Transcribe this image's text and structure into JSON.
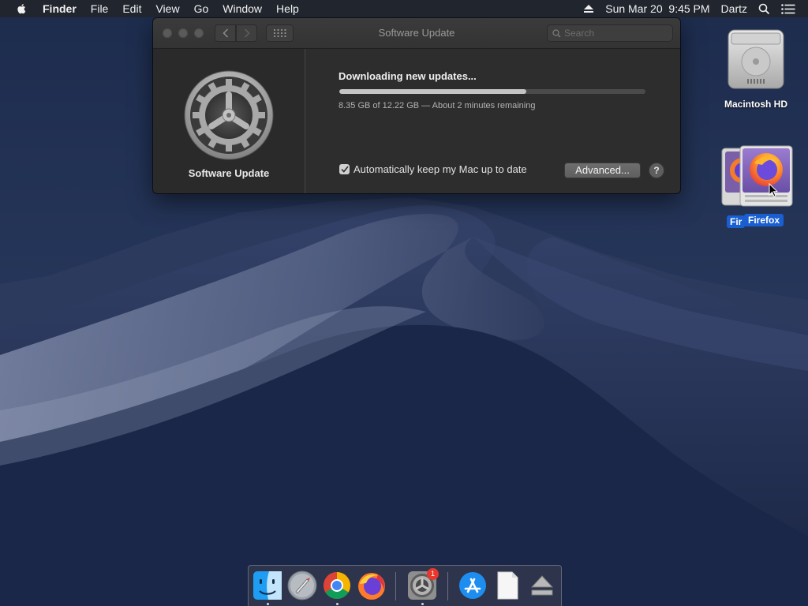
{
  "menubar": {
    "app_name": "Finder",
    "menus": [
      "File",
      "Edit",
      "View",
      "Go",
      "Window",
      "Help"
    ],
    "datetime": "Sun Mar 20  9:45 PM",
    "user": "Dartz"
  },
  "window": {
    "title": "Software Update",
    "search_placeholder": "Search",
    "pane_label": "Software Update",
    "status": "Downloading new updates...",
    "progress_fraction": 0.61,
    "progress_detail": "8.35 GB of 12.22 GB — About 2 minutes remaining",
    "auto_update_label": "Automatically keep my Mac up to date",
    "auto_update_checked": true,
    "advanced_label": "Advanced...",
    "help_label": "?"
  },
  "desktop": {
    "icons": [
      {
        "label": "Macintosh HD",
        "icon": "hard-drive-icon"
      },
      {
        "label": "Firefox",
        "icon": "firefox-disk-image-icon"
      }
    ],
    "firefox_back_label": "Fir"
  },
  "dock": {
    "items": [
      {
        "icon": "finder-icon",
        "running": true
      },
      {
        "icon": "launchpad-icon",
        "running": false
      },
      {
        "icon": "chrome-icon",
        "running": true
      },
      {
        "icon": "firefox-icon",
        "running": false
      },
      {
        "icon": "system-preferences-icon",
        "running": true,
        "badge": "1"
      },
      {
        "icon": "app-store-icon",
        "running": false
      },
      {
        "icon": "document-icon",
        "running": false
      },
      {
        "icon": "eject-icon",
        "running": false
      }
    ],
    "badge": "1"
  },
  "colors": {
    "menubar_bg": "#22242a",
    "window_bg": "#2d2d2d",
    "progress_fill": "#c4c4c4",
    "selection_blue": "#1a5fd1",
    "badge_red": "#e8372c"
  }
}
